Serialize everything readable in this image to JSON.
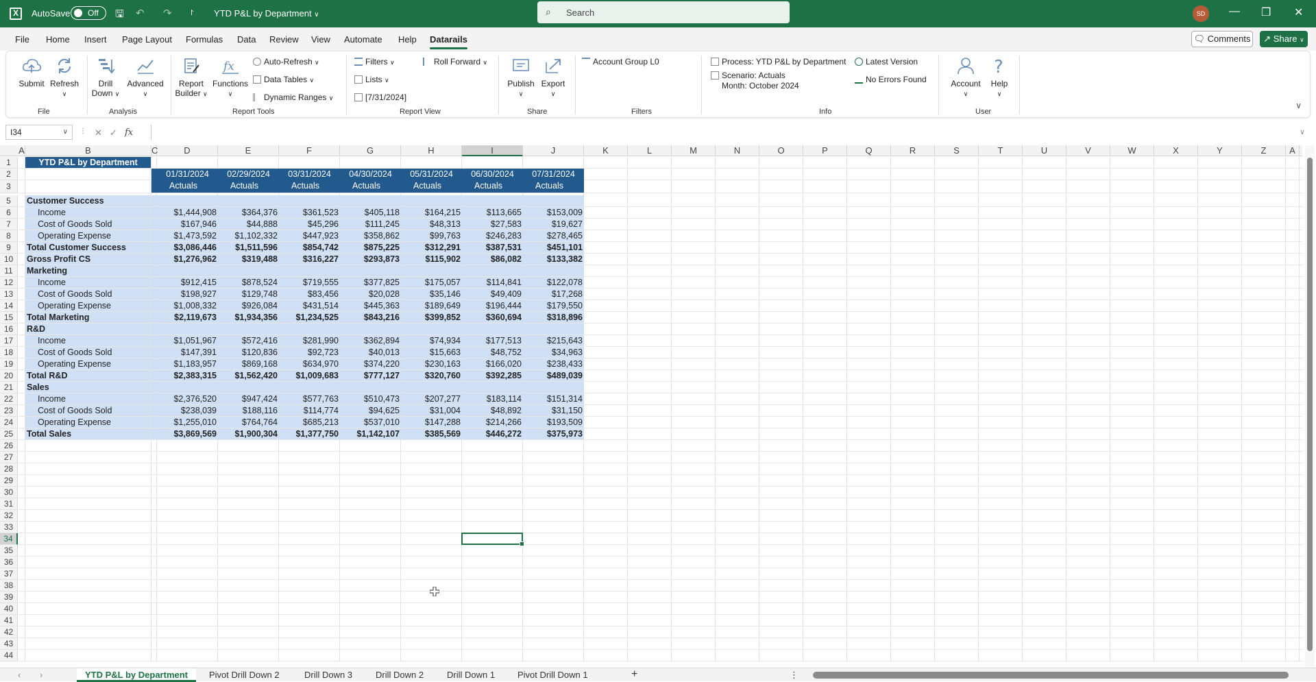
{
  "titlebar": {
    "autosave_label": "AutoSave",
    "toggle_state": "Off",
    "doc_title": "YTD P&L by Department",
    "search_placeholder": "Search",
    "avatar_initials": "SD"
  },
  "menu": {
    "tabs": [
      "File",
      "Home",
      "Insert",
      "Page Layout",
      "Formulas",
      "Data",
      "Review",
      "View",
      "Automate",
      "Help",
      "Datarails"
    ],
    "active": "Datarails",
    "comments_label": "Comments",
    "share_label": "Share"
  },
  "ribbon": {
    "submit": "Submit",
    "refresh": "Refresh",
    "drill_down_1": "Drill",
    "drill_down_2": "Down",
    "advanced": "Advanced",
    "report_builder_1": "Report",
    "report_builder_2": "Builder",
    "functions": "Functions",
    "auto_refresh": "Auto-Refresh",
    "data_tables": "Data Tables",
    "dynamic_ranges": "Dynamic Ranges",
    "filters": "Filters",
    "lists": "Lists",
    "date_value": "[7/31/2024]",
    "roll_forward": "Roll Forward",
    "publish": "Publish",
    "export": "Export",
    "account_group": "Account Group L0",
    "process": "Process: YTD P&L by Department",
    "latest_version": "Latest Version",
    "scenario": "Scenario: Actuals",
    "month": "Month: October 2024",
    "no_errors": "No Errors Found",
    "account": "Account",
    "help": "Help",
    "groups": {
      "file": "File",
      "analysis": "Analysis",
      "report_tools": "Report Tools",
      "report_view": "Report View",
      "share": "Share",
      "filters": "Filters",
      "info": "Info",
      "user": "User"
    }
  },
  "formula_bar": {
    "name_box": "I34",
    "fx": "fx",
    "value": ""
  },
  "columns": [
    "A",
    "B",
    "C",
    "D",
    "E",
    "F",
    "G",
    "H",
    "I",
    "J",
    "K",
    "L",
    "M",
    "N",
    "O",
    "P",
    "Q",
    "R",
    "S",
    "T",
    "U",
    "V",
    "W",
    "X",
    "Y",
    "Z",
    "A"
  ],
  "rows": [
    "1",
    "2",
    "3",
    "5",
    "6",
    "7",
    "8",
    "9",
    "10",
    "11",
    "12",
    "13",
    "14",
    "15",
    "16",
    "17",
    "18",
    "19",
    "20",
    "21",
    "22",
    "23",
    "24",
    "25",
    "26",
    "27",
    "28",
    "29",
    "30",
    "31",
    "32",
    "33",
    "34",
    "35",
    "36",
    "37",
    "38",
    "39",
    "40",
    "41",
    "42",
    "43",
    "44"
  ],
  "sheet": {
    "title": "YTD P&L by Department",
    "header_dates": [
      "01/31/2024",
      "02/29/2024",
      "03/31/2024",
      "04/30/2024",
      "05/31/2024",
      "06/30/2024",
      "07/31/2024"
    ],
    "header_scenario": [
      "Actuals",
      "Actuals",
      "Actuals",
      "Actuals",
      "Actuals",
      "Actuals",
      "Actuals"
    ],
    "lines": [
      {
        "label": "Customer Success",
        "type": "section",
        "values": []
      },
      {
        "label": "Income",
        "type": "item",
        "values": [
          "$1,444,908",
          "$364,376",
          "$361,523",
          "$405,118",
          "$164,215",
          "$113,665",
          "$153,009"
        ]
      },
      {
        "label": "Cost of Goods Sold",
        "type": "item",
        "values": [
          "$167,946",
          "$44,888",
          "$45,296",
          "$111,245",
          "$48,313",
          "$27,583",
          "$19,627"
        ]
      },
      {
        "label": "Operating Expense",
        "type": "item",
        "values": [
          "$1,473,592",
          "$1,102,332",
          "$447,923",
          "$358,862",
          "$99,763",
          "$246,283",
          "$278,465"
        ]
      },
      {
        "label": "Total Customer Success",
        "type": "total",
        "values": [
          "$3,086,446",
          "$1,511,596",
          "$854,742",
          "$875,225",
          "$312,291",
          "$387,531",
          "$451,101"
        ]
      },
      {
        "label": "Gross Profit CS",
        "type": "total",
        "values": [
          "$1,276,962",
          "$319,488",
          "$316,227",
          "$293,873",
          "$115,902",
          "$86,082",
          "$133,382"
        ]
      },
      {
        "label": "Marketing",
        "type": "section",
        "values": []
      },
      {
        "label": "Income",
        "type": "item",
        "values": [
          "$912,415",
          "$878,524",
          "$719,555",
          "$377,825",
          "$175,057",
          "$114,841",
          "$122,078"
        ]
      },
      {
        "label": "Cost of Goods Sold",
        "type": "item",
        "values": [
          "$198,927",
          "$129,748",
          "$83,456",
          "$20,028",
          "$35,146",
          "$49,409",
          "$17,268"
        ]
      },
      {
        "label": "Operating Expense",
        "type": "item",
        "values": [
          "$1,008,332",
          "$926,084",
          "$431,514",
          "$445,363",
          "$189,649",
          "$196,444",
          "$179,550"
        ]
      },
      {
        "label": "Total Marketing",
        "type": "total",
        "values": [
          "$2,119,673",
          "$1,934,356",
          "$1,234,525",
          "$843,216",
          "$399,852",
          "$360,694",
          "$318,896"
        ]
      },
      {
        "label": "R&D",
        "type": "section",
        "values": []
      },
      {
        "label": "Income",
        "type": "item",
        "values": [
          "$1,051,967",
          "$572,416",
          "$281,990",
          "$362,894",
          "$74,934",
          "$177,513",
          "$215,643"
        ]
      },
      {
        "label": "Cost of Goods Sold",
        "type": "item",
        "values": [
          "$147,391",
          "$120,836",
          "$92,723",
          "$40,013",
          "$15,663",
          "$48,752",
          "$34,963"
        ]
      },
      {
        "label": "Operating Expense",
        "type": "item",
        "values": [
          "$1,183,957",
          "$869,168",
          "$634,970",
          "$374,220",
          "$230,163",
          "$166,020",
          "$238,433"
        ]
      },
      {
        "label": "Total R&D",
        "type": "total",
        "values": [
          "$2,383,315",
          "$1,562,420",
          "$1,009,683",
          "$777,127",
          "$320,760",
          "$392,285",
          "$489,039"
        ]
      },
      {
        "label": "Sales",
        "type": "section",
        "values": []
      },
      {
        "label": "Income",
        "type": "item",
        "values": [
          "$2,376,520",
          "$947,424",
          "$577,763",
          "$510,473",
          "$207,277",
          "$183,114",
          "$151,314"
        ]
      },
      {
        "label": "Cost of Goods Sold",
        "type": "item",
        "values": [
          "$238,039",
          "$188,116",
          "$114,774",
          "$94,625",
          "$31,004",
          "$48,892",
          "$31,150"
        ]
      },
      {
        "label": "Operating Expense",
        "type": "item",
        "values": [
          "$1,255,010",
          "$764,764",
          "$685,213",
          "$537,010",
          "$147,288",
          "$214,266",
          "$193,509"
        ]
      },
      {
        "label": "Total Sales",
        "type": "total",
        "values": [
          "$3,869,569",
          "$1,900,304",
          "$1,377,750",
          "$1,142,107",
          "$385,569",
          "$446,272",
          "$375,973"
        ]
      }
    ]
  },
  "sheet_tabs": [
    "YTD P&L by Department",
    "Pivot Drill Down 2",
    "Drill Down 3",
    "Drill Down 2",
    "Drill Down 1",
    "Pivot Drill Down 1"
  ],
  "active_sheet": "YTD P&L by Department",
  "add_sheet": "+",
  "colors": {
    "excel_green": "#1e7145",
    "header_blue": "#235a8e",
    "selection_blue": "#cfe0f5"
  }
}
